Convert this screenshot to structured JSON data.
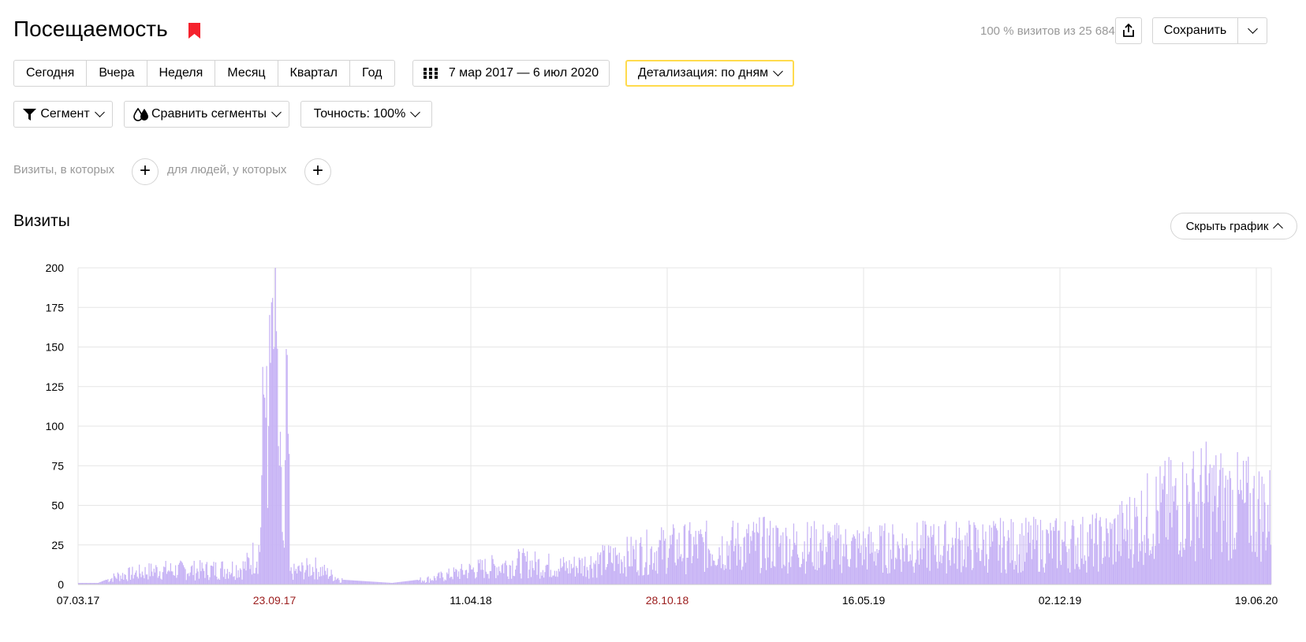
{
  "header": {
    "title": "Посещаемость",
    "visits_info": "100 % визитов из 25 684",
    "save_label": "Сохранить",
    "bookmark_color": "#f5222d"
  },
  "periods": [
    "Сегодня",
    "Вчера",
    "Неделя",
    "Месяц",
    "Квартал",
    "Год"
  ],
  "date_range": "7 мар 2017 — 6 июл 2020",
  "detail": "Детализация: по дням",
  "segment_label": "Сегмент",
  "compare_label": "Сравнить сегменты",
  "accuracy_label": "Точность: 100%",
  "filters": {
    "visits_text": "Визиты, в которых",
    "people_text": "для людей, у которых"
  },
  "chart_section": {
    "title": "Визиты",
    "hide_label": "Скрыть график"
  },
  "colors": {
    "bar": "#c7b3f5",
    "highlight_border": "#ffdb4d",
    "weekend_label": "#9b1c1c"
  },
  "chart_data": {
    "type": "bar",
    "title": "",
    "xlabel": "",
    "ylabel": "",
    "ylim": [
      0,
      200
    ],
    "y_ticks": [
      0,
      25,
      50,
      75,
      100,
      125,
      150,
      175,
      200
    ],
    "x_ticks": [
      {
        "label": "07.03.17",
        "weekend": false
      },
      {
        "label": "23.09.17",
        "weekend": true
      },
      {
        "label": "11.04.18",
        "weekend": false
      },
      {
        "label": "28.10.18",
        "weekend": true
      },
      {
        "label": "16.05.19",
        "weekend": false
      },
      {
        "label": "02.12.19",
        "weekend": false
      },
      {
        "label": "19.06.20",
        "weekend": false
      }
    ],
    "grid": true,
    "series": [
      {
        "name": "Визиты",
        "keypoints": [
          {
            "day": 0,
            "value": 1
          },
          {
            "day": 20,
            "value": 1
          },
          {
            "day": 40,
            "value": 6
          },
          {
            "day": 80,
            "value": 10
          },
          {
            "day": 130,
            "value": 10
          },
          {
            "day": 170,
            "value": 12
          },
          {
            "day": 185,
            "value": 25
          },
          {
            "day": 189,
            "value": 120
          },
          {
            "day": 192,
            "value": 138
          },
          {
            "day": 194,
            "value": 100
          },
          {
            "day": 196,
            "value": 140
          },
          {
            "day": 198,
            "value": 181
          },
          {
            "day": 200,
            "value": 150
          },
          {
            "day": 202,
            "value": 160
          },
          {
            "day": 205,
            "value": 75
          },
          {
            "day": 210,
            "value": 20
          },
          {
            "day": 213,
            "value": 145
          },
          {
            "day": 216,
            "value": 8
          },
          {
            "day": 240,
            "value": 12
          },
          {
            "day": 270,
            "value": 3
          },
          {
            "day": 320,
            "value": 1
          },
          {
            "day": 360,
            "value": 4
          },
          {
            "day": 400,
            "value": 10
          },
          {
            "day": 450,
            "value": 15
          },
          {
            "day": 500,
            "value": 12
          },
          {
            "day": 600,
            "value": 25
          },
          {
            "day": 700,
            "value": 28
          },
          {
            "day": 800,
            "value": 25
          },
          {
            "day": 900,
            "value": 27
          },
          {
            "day": 1000,
            "value": 28
          },
          {
            "day": 1050,
            "value": 30
          },
          {
            "day": 1100,
            "value": 50
          },
          {
            "day": 1150,
            "value": 60
          },
          {
            "day": 1180,
            "value": 55
          },
          {
            "day": 1217,
            "value": 50
          }
        ]
      }
    ]
  }
}
